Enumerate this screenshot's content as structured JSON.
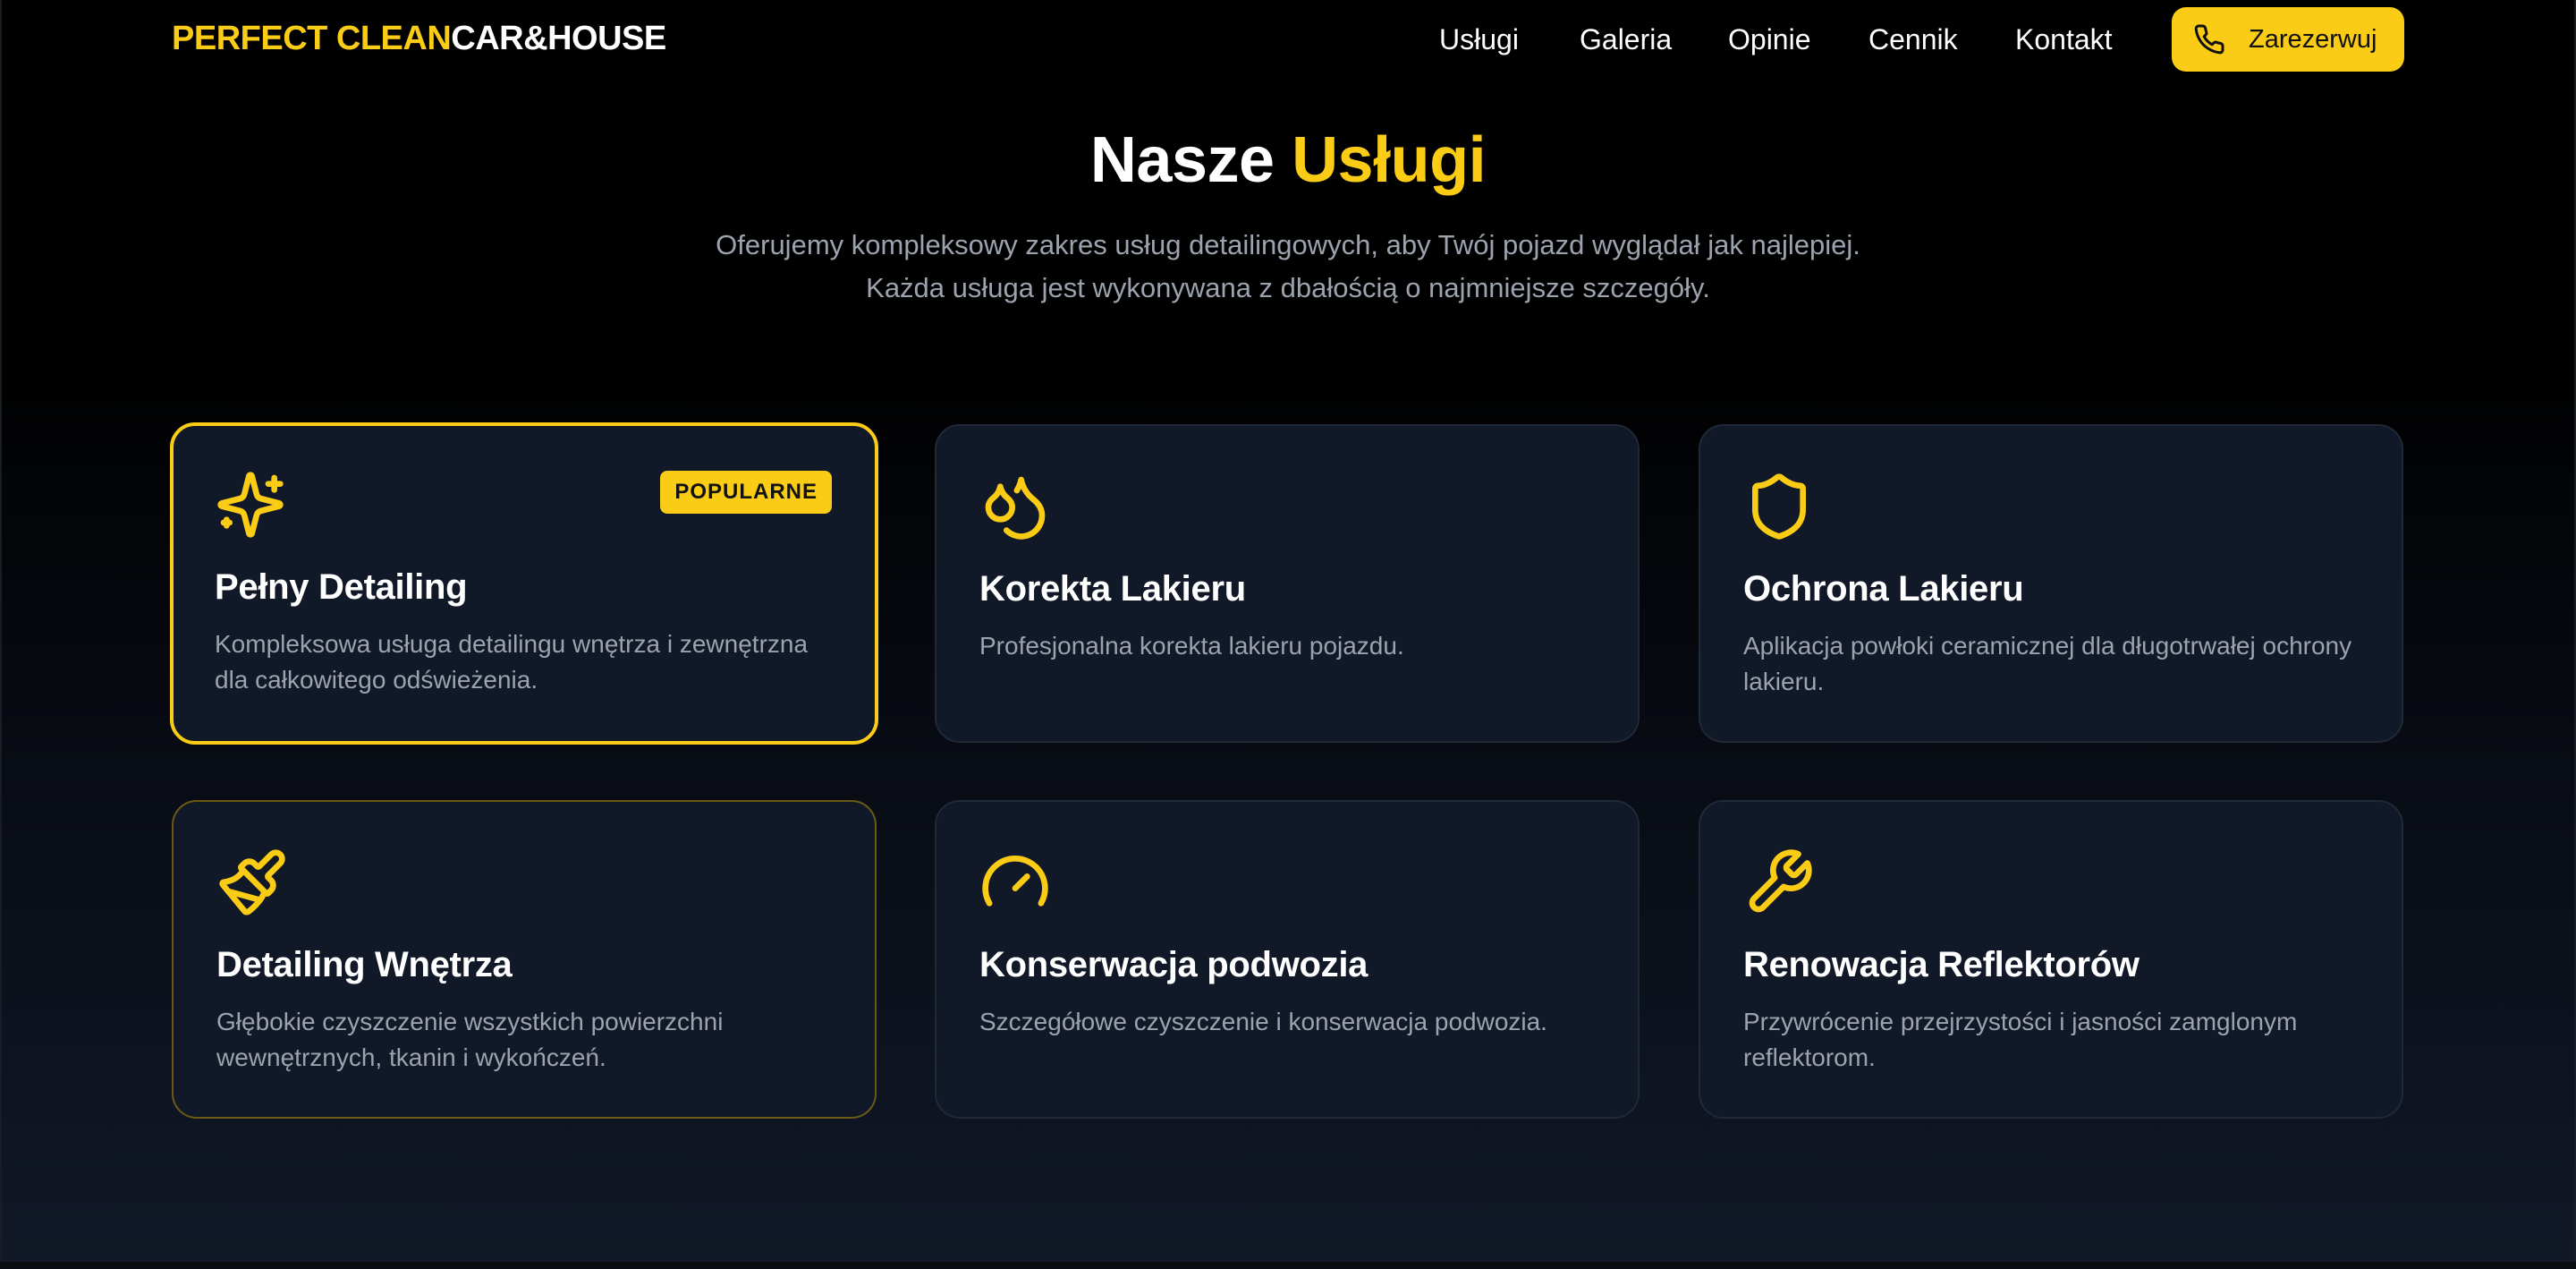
{
  "brand": {
    "part1": "PERFECT CLEAN",
    "part2": "CAR&HOUSE"
  },
  "nav": {
    "links": [
      "Usługi",
      "Galeria",
      "Opinie",
      "Cennik",
      "Kontakt"
    ],
    "cta_label": "Zarezerwuj",
    "cta_icon": "phone-icon"
  },
  "colors": {
    "accent": "#facc15",
    "card_bg": "#111827",
    "muted_text": "#9ca3af"
  },
  "hero": {
    "title_part1": "Nasze",
    "title_part2": "Usługi",
    "subtitle": "Oferujemy kompleksowy zakres usług detailingowych, aby Twój pojazd wyglądał jak najlepiej. Każda usługa jest wykonywana z dbałością o najmniejsze szczegóły."
  },
  "services": [
    {
      "title": "Pełny Detailing",
      "description": "Kompleksowa usługa detailingu wnętrza i zewnętrzna dla całkowitego odświeżenia.",
      "icon": "sparkles-icon",
      "badge": "POPULARNE"
    },
    {
      "title": "Korekta Lakieru",
      "description": "Profesjonalna korekta lakieru pojazdu.",
      "icon": "droplets-icon"
    },
    {
      "title": "Ochrona Lakieru",
      "description": "Aplikacja powłoki ceramicznej dla długotrwałej ochrony lakieru.",
      "icon": "shield-icon"
    },
    {
      "title": "Detailing Wnętrza",
      "description": "Głębokie czyszczenie wszystkich powierzchni wewnętrznych, tkanin i wykończeń.",
      "icon": "paintbrush-icon"
    },
    {
      "title": "Konserwacja podwozia",
      "description": "Szczegółowe czyszczenie i konserwacja podwozia.",
      "icon": "gauge-icon"
    },
    {
      "title": "Renowacja Reflektorów",
      "description": "Przywrócenie przejrzystości i jasności zamglonym reflektorom.",
      "icon": "wrench-icon"
    }
  ]
}
